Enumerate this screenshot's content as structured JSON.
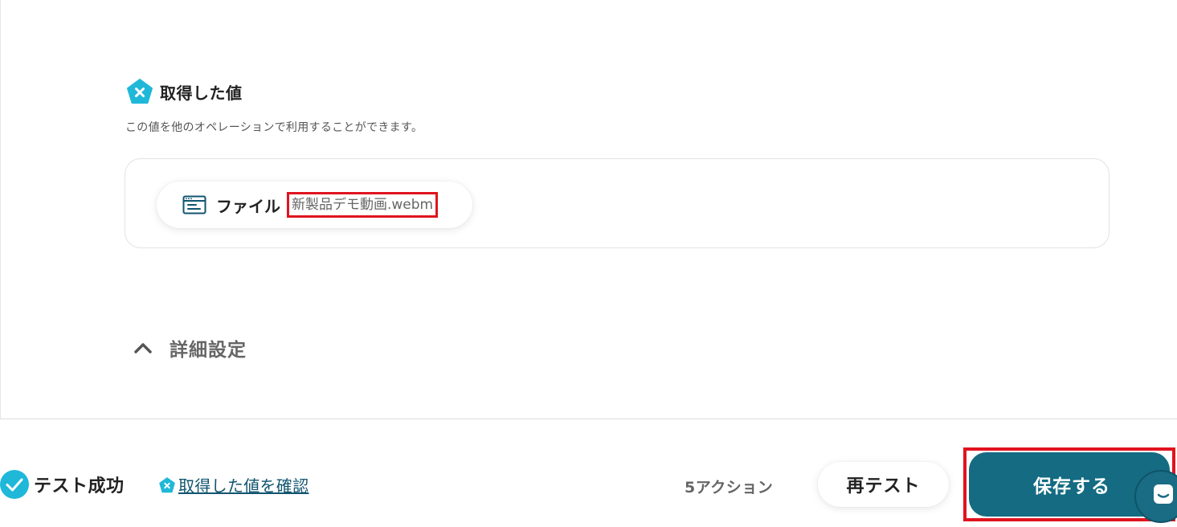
{
  "section": {
    "title": "取得した値",
    "description": "この値を他のオペレーションで利用することができます。",
    "icon": "yoom-pentagon-icon"
  },
  "value_item": {
    "icon": "file-window-icon",
    "label": "ファイル",
    "value": "新製品デモ動画.webm"
  },
  "details": {
    "label": "詳細設定",
    "icon": "chevron-up-icon"
  },
  "footer": {
    "status": "テスト成功",
    "confirm_link": "取得した値を確認",
    "action_count": "5アクション",
    "retest_label": "再テスト",
    "save_label": "保存する"
  },
  "colors": {
    "accent": "#1fb8d9",
    "primary_button": "#146b82",
    "highlight_frame": "#e0141e",
    "link": "#11556f"
  }
}
